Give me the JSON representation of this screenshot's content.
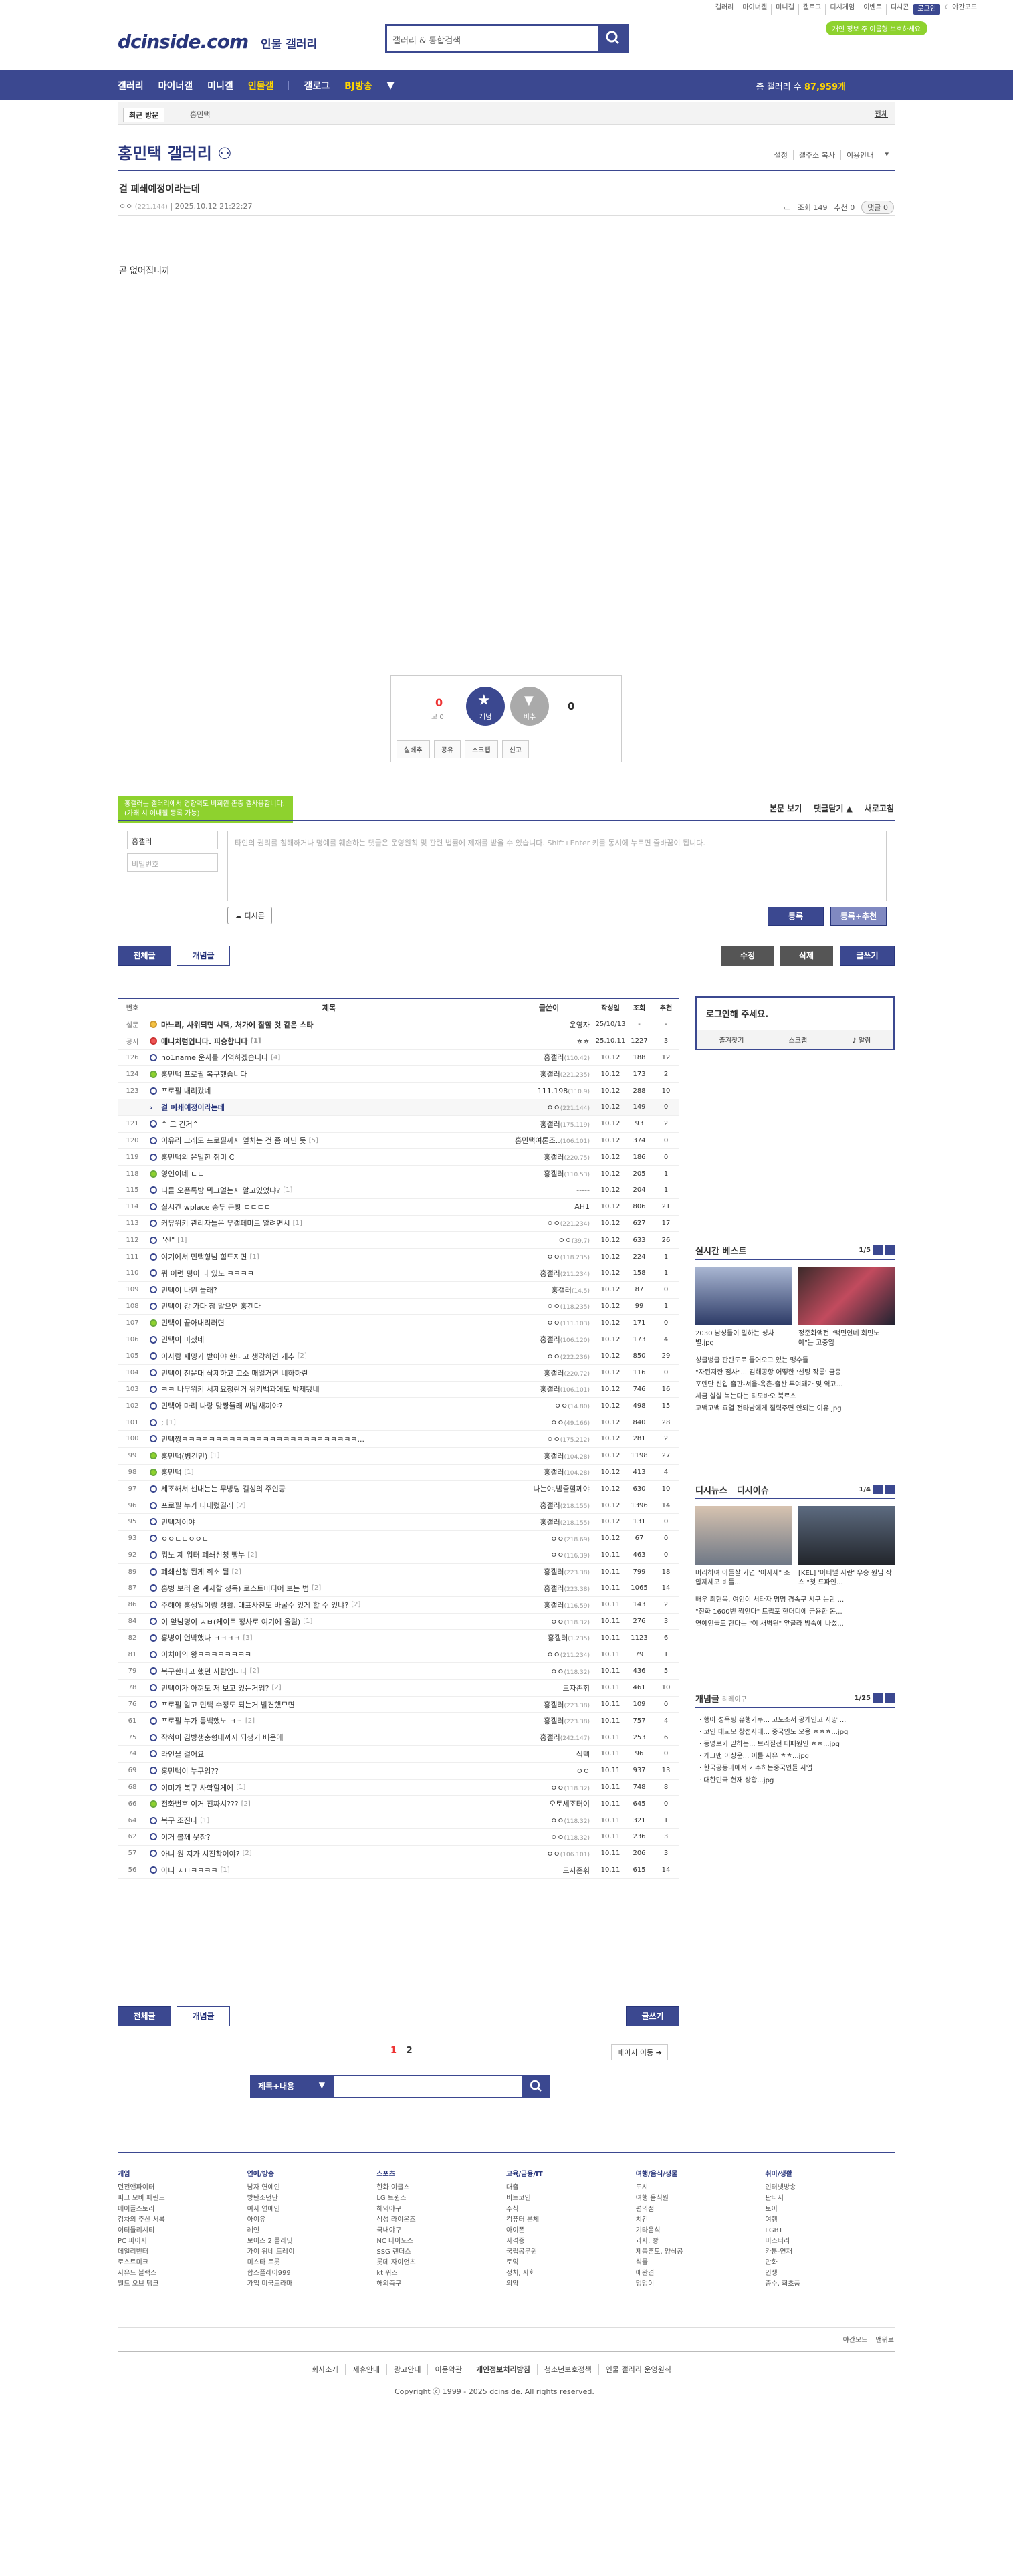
{
  "util": {
    "links": [
      "갤러리",
      "마이너갤",
      "미니갤",
      "갤로그",
      "디시게임",
      "이벤트",
      "디시콘"
    ],
    "login": "로그인",
    "dark": "야간모드",
    "pill": "개인 정보 주 이름형 보호하세요"
  },
  "logo": "dcinside.com",
  "logo_sub": "인물 갤러리",
  "search": {
    "placeholder": "갤러리 & 통합검색"
  },
  "gnb": {
    "items": [
      "갤러리",
      "마이너갤",
      "미니갤",
      "인물갤",
      "갤로그",
      "BJ방송"
    ],
    "count_label": "총 갤러리 수",
    "count": "87,959개"
  },
  "recent": {
    "tab": "최근 방문",
    "item": "홍민택",
    "all": "전체"
  },
  "gallery_title": "홍민택 갤러리",
  "title_right": [
    "설정",
    "갤주소 복사",
    "이용안내"
  ],
  "post": {
    "title": "걸 폐쇄예정이라는데",
    "author": "ㅇㅇ",
    "ip": "(221.144)",
    "date": "2025.10.12 21:22:27",
    "views": "조회 149",
    "recs": "추천 0",
    "replies": "댓글 0",
    "body": "곧 없어집니까"
  },
  "rec": {
    "up": "0",
    "fix": "고 0",
    "up_label": "개념",
    "down_label": "비추",
    "down": "0",
    "buttons": [
      "실베추",
      "공유",
      "스크랩",
      "신고"
    ]
  },
  "comment": {
    "tip": "홍갤러는 갤러리에서 영향력도 비회원 존중 갤사용합니다. (가래 시 이내될 등록 가능)",
    "right": [
      "본문 보기",
      "댓글닫기 ▲",
      "새로고침"
    ],
    "name": "홍갤러",
    "pw": "비밀번호",
    "text": "타인의 권리를 침해하거나 명예를 훼손하는 댓글은 운영원칙 및 관련 법률에 제재를 받을 수 있습니다. Shift+Enter 키를 동시에 누르면 줄바꿈이 됩니다.",
    "dccon": "디시콘",
    "submit": "등록",
    "submit_rec": "등록+추천"
  },
  "tabs": {
    "all": "전체글",
    "concept": "개념글",
    "edit": "수정",
    "delete": "삭제",
    "write": "글쓰기"
  },
  "table": {
    "headers": [
      "번호",
      "제목",
      "글쓴이",
      "작성일",
      "조회",
      "추천"
    ],
    "rows": [
      [
        "설문",
        "ann",
        "마느리, 사위되면 시댁, 처가에 잘할 것 같은 스타",
        "",
        "운영자",
        "",
        "25/10/13",
        "-",
        "-",
        "bold"
      ],
      [
        "공지",
        "r",
        "애니처럼입니다. 피승합니다",
        "[1]",
        "ㅎㅎ",
        "",
        "25.10.11",
        "1227",
        "3",
        "bold"
      ],
      [
        "126",
        "",
        "no1name 운사를 기억하겠습니다",
        "[4]",
        "홍갤러",
        "(110.42)",
        "10.12",
        "188",
        "12",
        ""
      ],
      [
        "124",
        "g",
        "홍민택 프로필 복구했습니다",
        "",
        "홍갤러",
        "(221.235)",
        "10.12",
        "173",
        "2",
        ""
      ],
      [
        "123",
        "",
        "프로필 내려갔네",
        "",
        "111.198",
        "(110.9)",
        "10.12",
        "288",
        "10",
        ""
      ],
      [
        "",
        "",
        "걸 폐쇄예정이라는데",
        "",
        "ㅇㅇ",
        "(221.144)",
        "10.12",
        "149",
        "0",
        "cur"
      ],
      [
        "121",
        "",
        "^ 그 긴거^",
        "",
        "홍갤러",
        "(175.119)",
        "10.12",
        "93",
        "2",
        ""
      ],
      [
        "120",
        "",
        "이유리 그래도 프로필까지 엎치는 건 좀 아닌 듯",
        "[5]",
        "홍민택여론조..",
        "(106.101)",
        "10.12",
        "374",
        "0",
        ""
      ],
      [
        "119",
        "",
        "홍민택의 은밀한 취미 C",
        "",
        "홍갤러",
        "(220.75)",
        "10.12",
        "186",
        "0",
        ""
      ],
      [
        "118",
        "g",
        "영인이네 ㄷㄷ",
        "",
        "홍갤러",
        "(110.53)",
        "10.12",
        "205",
        "1",
        ""
      ],
      [
        "115",
        "",
        "니들 오픈톡방 뭐그얼는지 알고있었냐?",
        "[1]",
        "-----",
        "",
        "10.12",
        "204",
        "1",
        ""
      ],
      [
        "114",
        "",
        "실시간 wplace 중두 근황 ㄷㄷㄷㄷ",
        "",
        "AH1",
        "",
        "10.12",
        "806",
        "21",
        ""
      ],
      [
        "113",
        "",
        "커뮤위키 관리자들은 무갤페미로 알려면시",
        "[1]",
        "ㅇㅇ",
        "(221.234)",
        "10.12",
        "627",
        "17",
        ""
      ],
      [
        "112",
        "",
        "\"신\"",
        "[1]",
        "ㅇㅇ",
        "(39.7)",
        "10.12",
        "633",
        "26",
        ""
      ],
      [
        "111",
        "",
        "여기에서 민택형님 힘드지면",
        "[1]",
        "ㅇㅇ",
        "(118.235)",
        "10.12",
        "224",
        "1",
        ""
      ],
      [
        "110",
        "",
        "뭐 이런 평이 다 있노 ㅋㅋㅋㅋ",
        "",
        "홍갤러",
        "(211.234)",
        "10.12",
        "158",
        "1",
        ""
      ],
      [
        "109",
        "",
        "민택이 나원 들래?",
        "",
        "홍갤러",
        "(14.5)",
        "10.12",
        "87",
        "0",
        ""
      ],
      [
        "108",
        "",
        "민택이 강 가다 참 말으면 홍겐다",
        "",
        "ㅇㅇ",
        "(118.235)",
        "10.12",
        "99",
        "1",
        ""
      ],
      [
        "107",
        "g",
        "민택이 끝아내리러면",
        "",
        "ㅇㅇ",
        "(111.103)",
        "10.12",
        "171",
        "0",
        ""
      ],
      [
        "106",
        "",
        "민택이 미첬네",
        "",
        "홍갤러",
        "(106.120)",
        "10.12",
        "173",
        "4",
        ""
      ],
      [
        "105",
        "",
        "이사람 재밍가 받아야 한다고 생각하면 개추",
        "[2]",
        "ㅇㅇ",
        "(222.236)",
        "10.12",
        "850",
        "29",
        ""
      ],
      [
        "104",
        "",
        "민택이 천문대 삭제하고 고소 매일거면 네하하란",
        "",
        "홍갤러",
        "(220.72)",
        "10.12",
        "116",
        "0",
        ""
      ],
      [
        "103",
        "",
        "ㅋㅋ 나무위키 서제요청란거 위키백과에도 박제됐네",
        "",
        "홍갤러",
        "(106.101)",
        "10.12",
        "746",
        "16",
        ""
      ],
      [
        "102",
        "",
        "민택아 마려 나랑 맞짱뜰래 씨발새끼야?",
        "",
        "ㅇㅇ",
        "(14.80)",
        "10.12",
        "498",
        "15",
        ""
      ],
      [
        "101",
        "",
        ";",
        "[1]",
        "ㅇㅇ",
        "(49.166)",
        "10.12",
        "840",
        "28",
        ""
      ],
      [
        "100",
        "",
        "민택짱ㅋㅋㅋㅋㅋㅋㅋㅋㅋㅋㅋㅋㅋㅋㅋㅋㅋㅋㅋㅋㅋㅋㅋㅋㅋㅋ...",
        "",
        "ㅇㅇ",
        "(175.212)",
        "10.12",
        "281",
        "2",
        ""
      ],
      [
        "99",
        "g",
        "홍민택(병건민)",
        "[1]",
        "홍갤러",
        "(104.28)",
        "10.12",
        "1198",
        "27",
        ""
      ],
      [
        "98",
        "g",
        "홍민택",
        "[1]",
        "홍갤러",
        "(104.28)",
        "10.12",
        "413",
        "4",
        ""
      ],
      [
        "97",
        "",
        "세조해서 센내는는 무방딩 걸성의 주인공",
        "",
        "나는야,밤졸할께야",
        "",
        "10.12",
        "630",
        "10",
        ""
      ],
      [
        "96",
        "",
        "프로필 누가 다내렸길래",
        "[2]",
        "홍갤러",
        "(218.155)",
        "10.12",
        "1396",
        "14",
        ""
      ],
      [
        "95",
        "",
        "민택계이야",
        "",
        "홍갤러",
        "(218.155)",
        "10.12",
        "131",
        "0",
        ""
      ],
      [
        "93",
        "",
        "ㅇㅇㄴㄴㅇㅇㄴ",
        "",
        "ㅇㅇ",
        "(218.69)",
        "10.12",
        "67",
        "0",
        ""
      ],
      [
        "92",
        "",
        "뭐노 제 워터 폐쇄신청 빵누",
        "[2]",
        "ㅇㅇ",
        "(116.39)",
        "10.11",
        "463",
        "0",
        ""
      ],
      [
        "89",
        "",
        "폐쇄신청 된게 취소 됨",
        "[2]",
        "홍갤러",
        "(223.38)",
        "10.11",
        "799",
        "18",
        ""
      ],
      [
        "87",
        "",
        "홍병 보러 온 계자할 청독) 로스트미디어 보는 법",
        "[2]",
        "홍갤러",
        "(223.38)",
        "10.11",
        "1065",
        "14",
        ""
      ],
      [
        "86",
        "",
        "주해야 홍생일이랑 생활, 대표사진도 바꿀수 있게 할 수 있냐?",
        "[2]",
        "홍갤러",
        "(116.59)",
        "10.11",
        "143",
        "2",
        ""
      ],
      [
        "84",
        "",
        "이 앞남명이 ㅅㅂ(케이트 정사로 여기에 올림)",
        "[1]",
        "ㅇㅇ",
        "(118.32)",
        "10.11",
        "276",
        "3",
        ""
      ],
      [
        "82",
        "",
        "홍병이 언박했나 ㅋㅋㅋㅋ",
        "[3]",
        "홍갤러",
        "(1.235)",
        "10.11",
        "1123",
        "6",
        ""
      ],
      [
        "81",
        "",
        "이치에의 왕ㅋㅋㅋㅋㅋㅋㅋㅋ",
        "",
        "ㅇㅇ",
        "(211.234)",
        "10.11",
        "79",
        "1",
        ""
      ],
      [
        "79",
        "",
        "복구한다고 했던 사람입니다",
        "[2]",
        "ㅇㅇ",
        "(118.32)",
        "10.11",
        "436",
        "5",
        ""
      ],
      [
        "78",
        "",
        "민택이가 아껴도 저 보고 있는거임?",
        "[2]",
        "모자존휘",
        "",
        "10.11",
        "461",
        "10",
        ""
      ],
      [
        "76",
        "",
        "프로필 알고 민택 수정도 되는거 발견했므면",
        "",
        "홍갤러",
        "(223.38)",
        "10.11",
        "109",
        "0",
        ""
      ],
      [
        "61",
        "",
        "프로필 누가 통백했노 ㅋㅋ",
        "[2]",
        "홍갤러",
        "(223.38)",
        "10.11",
        "757",
        "4",
        ""
      ],
      [
        "75",
        "",
        "작혀이 김방생충형대까지 되생기 배운에",
        "",
        "홍갤러",
        "(242.147)",
        "10.11",
        "253",
        "6",
        ""
      ],
      [
        "74",
        "",
        "라인을 걸어요",
        "",
        "식택",
        "",
        "10.11",
        "96",
        "0",
        ""
      ],
      [
        "69",
        "",
        "홍민택이 누구임??",
        "",
        "ㅇㅇ",
        "",
        "10.11",
        "937",
        "13",
        ""
      ],
      [
        "68",
        "",
        "이미가 복구 사학할게에",
        "[1]",
        "ㅇㅇ",
        "(118.32)",
        "10.11",
        "748",
        "8",
        ""
      ],
      [
        "66",
        "g",
        "전화번호 이거 진짜시???",
        "[2]",
        "오토세조터이",
        "",
        "10.11",
        "645",
        "0",
        ""
      ],
      [
        "64",
        "",
        "복구 조진다",
        "[1]",
        "ㅇㅇ",
        "(118.32)",
        "10.11",
        "321",
        "1",
        ""
      ],
      [
        "62",
        "",
        "이거 볼께 웃참?",
        "",
        "ㅇㅇ",
        "(118.32)",
        "10.11",
        "236",
        "3",
        ""
      ],
      [
        "57",
        "",
        "아니 원 지가 시진착이야?",
        "[2]",
        "ㅇㅇ",
        "(106.101)",
        "10.11",
        "206",
        "3",
        ""
      ],
      [
        "56",
        "",
        "아니 ㅅㅂㅋㅋㅋㅋ",
        "[1]",
        "모자존휘",
        "",
        "10.11",
        "615",
        "14",
        ""
      ]
    ]
  },
  "login_box": {
    "title": "로그인해 주세요.",
    "links": [
      "즐겨찾기",
      "스크랩",
      "알림"
    ]
  },
  "realtime": {
    "title": "실시간 베스트",
    "page": "1/5",
    "thumbs": [
      "2030 남성들이 말하는 성차별.jpg",
      "정준화액전 \"백민인네 회민노예\"는 고충임"
    ],
    "list": [
      "싱글벙글 판탄도로 들어오고 있는 맹수들",
      "\"자된저한 점사\"... 김해공항 어떻한 '선팅 작롱' 금종",
      "포덴단 신입 출판-서울-옥촌-출산 투여돼가 및 역고...",
      "세금 살살 녹는다는 티모바오 북르스",
      "고백고백 요열 전타남에게 절력주면 안되는 이유.jpg"
    ]
  },
  "dcnews": {
    "tab1": "디시뉴스",
    "tab2": "디시이슈",
    "page": "1/4",
    "thumbs": [
      "머리하여 아들살 가면 \"이자세\" 조압제세모 비틀...",
      "[KEL] '아티널 사란' 우승 원님 작스 \"첫 드파인..."
    ],
    "list": [
      "배우 최현욱, 여인이 서타자 명명 경속구 시구 논란 ...",
      "\"진화 1600번 짝인다\" 트립포 한더디에 금용한 돈...",
      "연예인들도 한다는 \"이 새벽원\" 앞글라 방숙에 나섰..."
    ]
  },
  "concept": {
    "title": "개념글",
    "sub": "리레이구",
    "page": "1/25",
    "list": [
      "행아 성욕팅 유행가쿠... 고도소서 공개인고 사망 ...",
      "코인 대교모 창선사태... 중국인도 오용 ㅎㅎㅎ...jpg",
      "동명보카 맏하는... 브라질전 대패원인 ㅎㅎ...jpg",
      "개그맨 이상운... 이를 사유 ㅎㅎ...jpg",
      "한국공동마에서 거주하는중국인들 사업",
      "대한민국 현재 상황...jpg"
    ]
  },
  "tabs_bottom": {
    "all": "전체글",
    "concept": "개념글",
    "write": "글쓰기"
  },
  "pagination": {
    "pages": [
      "1",
      "2"
    ],
    "move": "페이지 이동"
  },
  "bottom_search": {
    "select": "제목+내용"
  },
  "footer_cols": [
    {
      "h": "게임",
      "items": [
        "던전앤파이터",
        "피그 모바 패린드",
        "메이플스토리",
        "검차의 추산 서록",
        "이터들리시티",
        "PC 파이지",
        "데일리번터",
        "로스트미크",
        "사유드 블랙스",
        "월드 오브 탱크"
      ]
    },
    {
      "h": "연예/방송",
      "items": [
        "남자 연예인",
        "방탄소년단",
        "여자 연예인",
        "아이유",
        "레인",
        "보이즈 2 플래닛",
        "가이 위네 드레이",
        "미스타 트롯",
        "합스플레이999",
        "가입 미국드라마"
      ]
    },
    {
      "h": "스포츠",
      "items": [
        "한화 이글스",
        "LG 트윈스",
        "해외야구",
        "삼성 라이온즈",
        "국내야구",
        "NC 다이노스",
        "SSG 랜더스",
        "롯데 자이언츠",
        "kt 위즈",
        "해외축구"
      ]
    },
    {
      "h": "교육/금융/IT",
      "items": [
        "대출",
        "비트코인",
        "주식",
        "컴퓨터 본체",
        "아이폰",
        "자격증",
        "국립공무원",
        "토익",
        "정치, 사회",
        "의약"
      ]
    },
    {
      "h": "여행/음식/생물",
      "items": [
        "도시",
        "여행 음식원",
        "편의점",
        "치킨",
        "기타음식",
        "과자, 빵",
        "제품혼도, 양식공",
        "식물",
        "애완견",
        "멍멍이"
      ]
    },
    {
      "h": "취미/생활",
      "items": [
        "인터넷방송",
        "판타지",
        "토이",
        "여행",
        "LGBT",
        "미스터리",
        "카툰-연재",
        "만화",
        "인생",
        "중수, 회초품"
      ]
    }
  ],
  "footer_mini": [
    "야간모드",
    "맨위로"
  ],
  "foot_bar": [
    "회사소개",
    "제휴안내",
    "광고안내",
    "이용약관",
    "개인정보처리방침",
    "청소년보호정책",
    "인물 갤러리 운영원칙"
  ],
  "copyright": "Copyright ⓒ 1999 - 2025 dcinside. All rights reserved."
}
